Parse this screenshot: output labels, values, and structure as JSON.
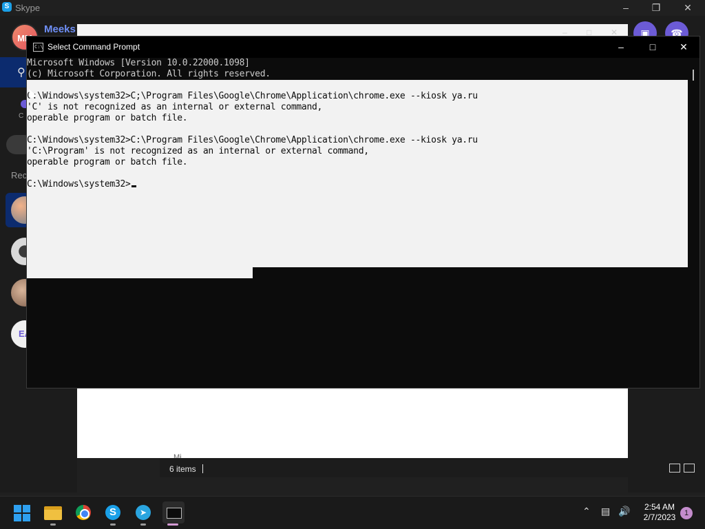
{
  "skype": {
    "title": "Skype",
    "me_initials": "MM",
    "me_name": "Meeks",
    "recent_label": "Rec",
    "contact_initials": "EA"
  },
  "explorer": {
    "status_items": "6 items",
    "folder_row": "Mi..."
  },
  "cmd": {
    "title": "Select Command Prompt",
    "lines": {
      "l0": "Microsoft Windows [Version 10.0.22000.1098]",
      "l1": "(c) Microsoft Corporation. All rights reserved.",
      "l3": "C:\\Windows\\system32>C;\\Program Files\\Google\\Chrome\\Application\\chrome.exe --kiosk ya.ru",
      "l4": "'C' is not recognized as an internal or external command,",
      "l5": "operable program or batch file.",
      "l7": "C:\\Windows\\system32>C:\\Program Files\\Google\\Chrome\\Application\\chrome.exe --kiosk ya.ru",
      "l8": "'C:\\Program' is not recognized as an internal or external command,",
      "l9": "operable program or batch file.",
      "l11": "C:\\Windows\\system32>"
    }
  },
  "taskbar": {
    "time": "2:54 AM",
    "date": "2/7/2023",
    "notification_count": "1"
  },
  "icons": [
    "skype-logo-icon",
    "search-icon",
    "chats-icon",
    "video-call-icon",
    "audio-call-icon",
    "minimize-icon",
    "maximize-icon",
    "close-icon",
    "cmd-app-icon",
    "start-icon",
    "file-explorer-icon",
    "chrome-icon",
    "skype-icon",
    "telegram-icon",
    "terminal-icon",
    "chevron-up-icon",
    "network-icon",
    "volume-icon",
    "details-view-icon",
    "thumbnail-view-icon"
  ],
  "colors": {
    "skype_accent": "#6c5bd6",
    "skype_blue": "#0c2b6e",
    "selection_bg": "#f2f2f2",
    "console_bg": "#0c0c0c"
  }
}
